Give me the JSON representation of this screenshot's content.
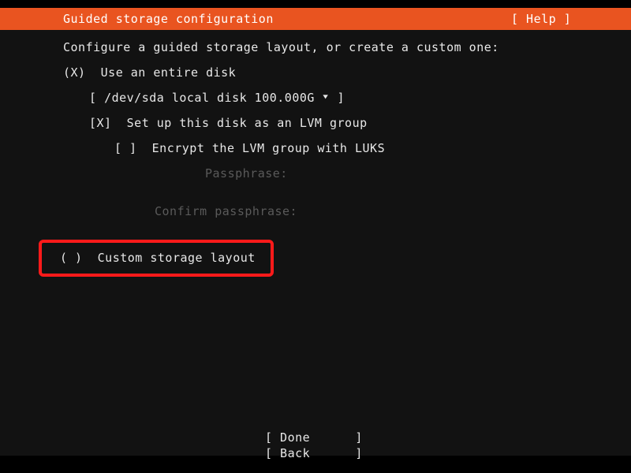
{
  "header": {
    "title": "Guided storage configuration",
    "help_label": "[ Help ]"
  },
  "main": {
    "prompt": "Configure a guided storage layout, or create a custom one:",
    "options": [
      {
        "marker": "(X)",
        "label": "Use an entire disk"
      }
    ],
    "disk_selector": {
      "open_bracket": "[",
      "value": "/dev/sda local disk 100.000G",
      "arrow_icon": "▼",
      "close_bracket": "]",
      "full_text": "[ /dev/sda local disk 100.000G ▼ ]"
    },
    "lvm_checkbox": {
      "marker": "[X]",
      "label": "Set up this disk as an LVM group"
    },
    "luks_checkbox": {
      "marker": "[ ]",
      "label": "Encrypt the LVM group with LUKS"
    },
    "passphrase_label": "Passphrase:",
    "confirm_passphrase_label": "Confirm passphrase:",
    "custom_option": {
      "marker": "( )",
      "label": "Custom storage layout"
    }
  },
  "footer": {
    "done_label": "[ Done      ]",
    "back_label": "[ Back      ]"
  },
  "colors": {
    "accent_orange": "#e95420",
    "terminal_bg": "#121212",
    "text": "#e8e8e8",
    "disabled_text": "#5a5a5a",
    "highlight_red": "#ff1a1a"
  }
}
